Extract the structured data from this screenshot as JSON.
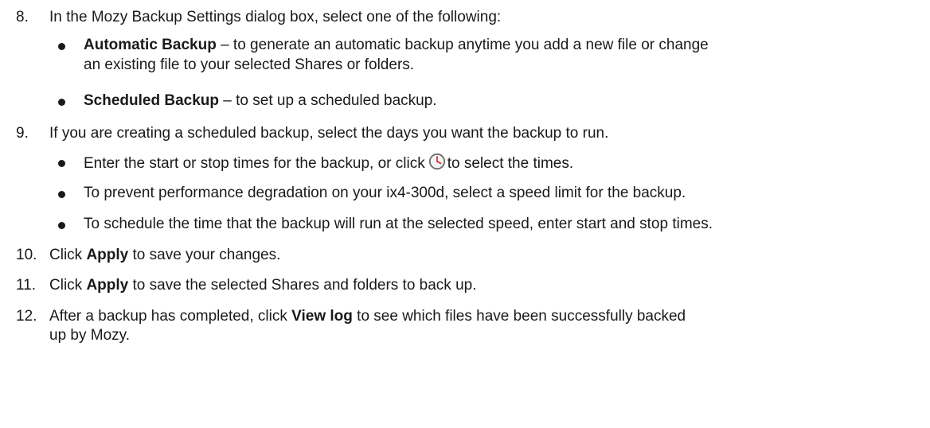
{
  "steps": {
    "s8": {
      "number": "8.",
      "text": "In the Mozy Backup Settings dialog box, select one of the following:",
      "bullets": [
        {
          "bold": "Automatic Backup",
          "text_line1": " – to generate an automatic backup anytime you add a new file or change",
          "text_line2": "an existing file to your selected Shares or folders."
        },
        {
          "bold": "Scheduled Backup",
          "text_line1": " – to set up a scheduled backup."
        }
      ]
    },
    "s9": {
      "number": "9.",
      "text": "If you are creating a scheduled backup, select the days you want the backup to run.",
      "bullets": [
        {
          "text_before_icon": "Enter the start or stop times for the backup, or click",
          "icon": "clock-icon",
          "text_after_icon": "to select the times."
        },
        {
          "text": "To prevent performance degradation on your ix4-300d, select a speed limit for the backup."
        },
        {
          "text": "To schedule the time that the backup will run at the selected speed, enter start and stop times."
        }
      ]
    },
    "s10": {
      "number": "10.",
      "before": "Click ",
      "bold": "Apply",
      "after": " to save your changes."
    },
    "s11": {
      "number": "11.",
      "before": "Click ",
      "bold": "Apply",
      "after": " to save the selected Shares and folders to back up."
    },
    "s12": {
      "number": "12.",
      "before": "After a backup has completed, click ",
      "bold": "View log",
      "after": " to see which files have been successfully backed",
      "line2": "up by Mozy."
    }
  },
  "colors": {
    "text": "#1a1a1a",
    "icon_stroke": "#6a6a6a",
    "icon_fill": "#f4f4f4",
    "icon_hand": "#d23a3a"
  }
}
